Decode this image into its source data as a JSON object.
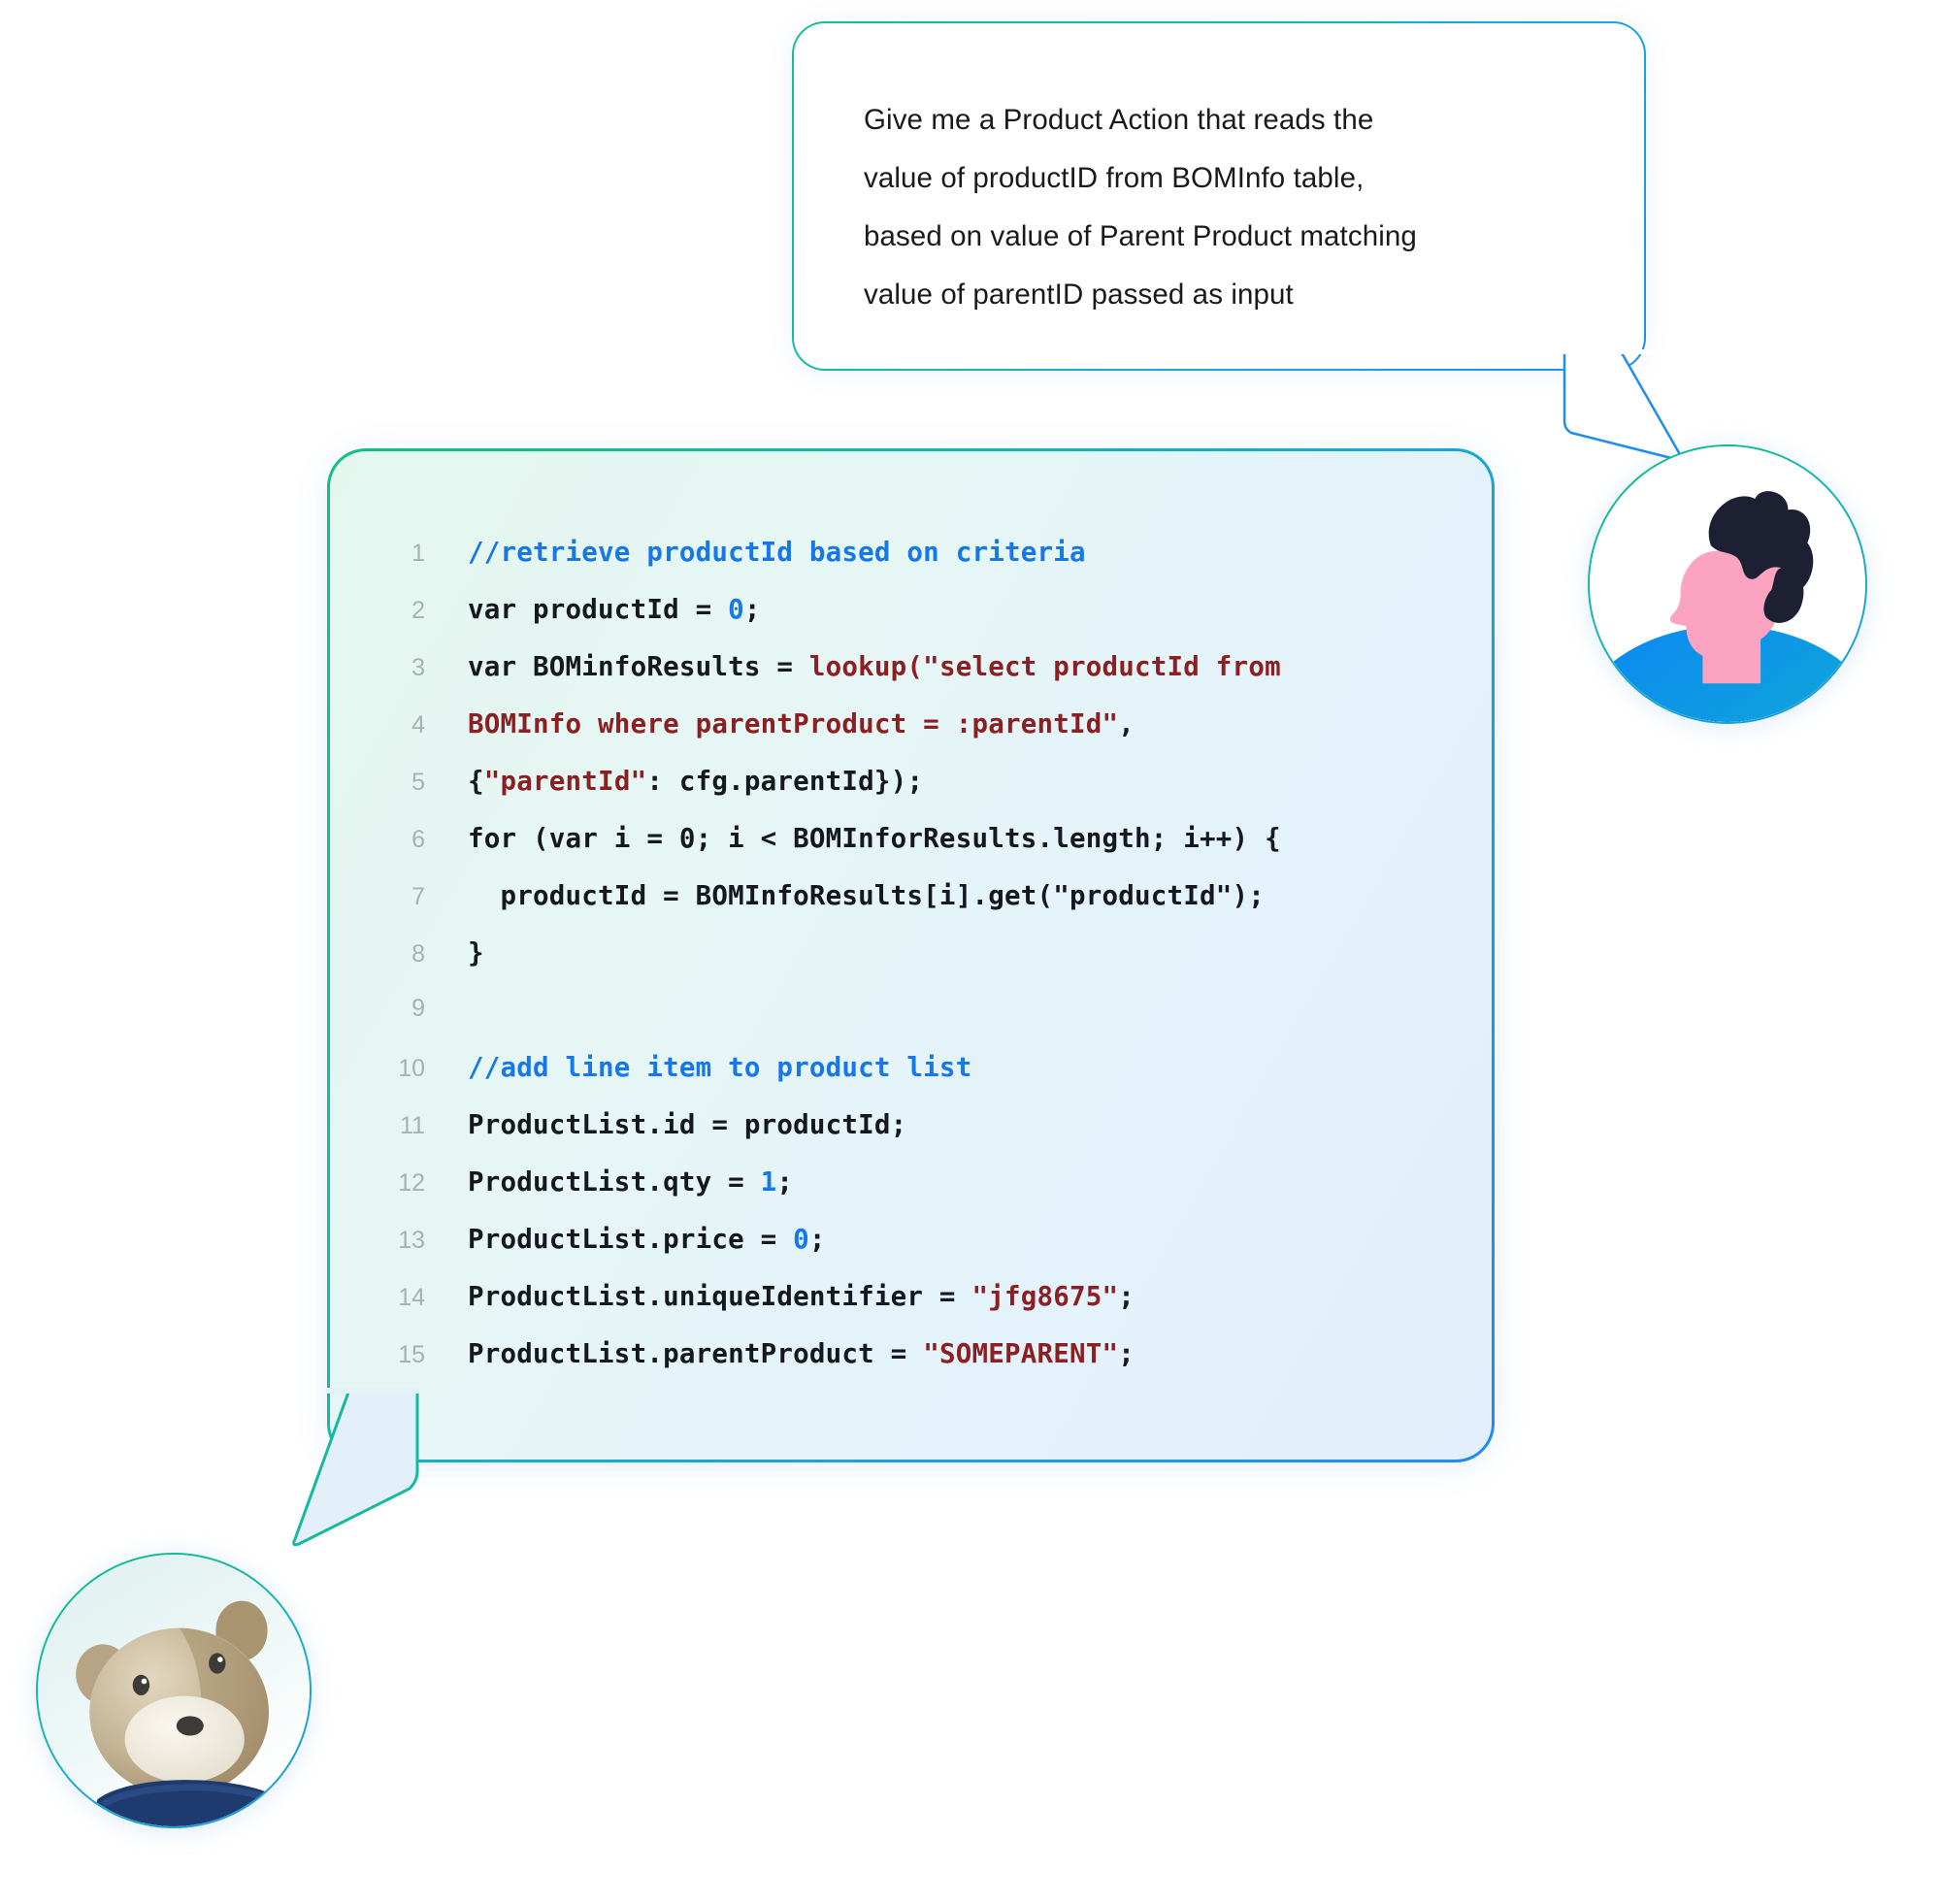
{
  "question": {
    "text": "Give me a Product Action that reads the\nvalue of productID from BOMInfo table,\nbased on value of Parent Product matching\nvalue of parentID passed as input"
  },
  "colors": {
    "comment": "#1677e8",
    "string": "#8c1f22",
    "number": "#1677e8",
    "code_text": "#15181c",
    "line_number": "#a7b0b2",
    "bubble_border_start": "#12bf83",
    "bubble_border_end": "#1f8cf1",
    "code_bubble_bg": "#e4f4f2"
  },
  "avatars": {
    "user": {
      "name": "person-avatar",
      "hair": "#1d2033",
      "skin": "#f9a0bd",
      "shirt_top": "#0d8bf2",
      "shirt_bottom": "#14b5c4"
    },
    "assistant": {
      "name": "bear-avatar",
      "fur_light": "#d9cdb4",
      "fur_dark": "#a08b6b",
      "muzzle": "#f2ede2",
      "scarf": "#1f3a6e",
      "bg": "#e8f5f4"
    }
  },
  "code": {
    "language": "javascript",
    "lines": [
      {
        "n": "1",
        "tokens": [
          {
            "t": "//retrieve productId based on criteria",
            "c": "comment"
          }
        ]
      },
      {
        "n": "2",
        "tokens": [
          {
            "t": "var productId = ",
            "c": "plain"
          },
          {
            "t": "0",
            "c": "num"
          },
          {
            "t": ";",
            "c": "plain"
          }
        ]
      },
      {
        "n": "3",
        "tokens": [
          {
            "t": "var BOMinfoResults = ",
            "c": "plain"
          },
          {
            "t": "lookup(\"select productId from",
            "c": "string"
          }
        ]
      },
      {
        "n": "4",
        "tokens": [
          {
            "t": "BOMInfo where parentProduct = :parentId\"",
            "c": "string"
          },
          {
            "t": ",",
            "c": "plain"
          }
        ]
      },
      {
        "n": "5",
        "tokens": [
          {
            "t": "{",
            "c": "plain"
          },
          {
            "t": "\"parentId\"",
            "c": "string"
          },
          {
            "t": ": cfg.parentId});",
            "c": "plain"
          }
        ]
      },
      {
        "n": "6",
        "tokens": [
          {
            "t": "for (var i = 0; i < BOMInforResults.length; i++) {",
            "c": "plain"
          }
        ]
      },
      {
        "n": "7",
        "tokens": [
          {
            "t": "  productId = BOMInfoResults[i].get(\"productId\");",
            "c": "plain"
          }
        ]
      },
      {
        "n": "8",
        "tokens": [
          {
            "t": "}",
            "c": "plain"
          }
        ]
      },
      {
        "n": "9",
        "tokens": [
          {
            "t": "",
            "c": "plain"
          }
        ]
      },
      {
        "n": "10",
        "tokens": [
          {
            "t": "//add line item to product list",
            "c": "comment"
          }
        ]
      },
      {
        "n": "11",
        "tokens": [
          {
            "t": "ProductList.id = productId;",
            "c": "plain"
          }
        ]
      },
      {
        "n": "12",
        "tokens": [
          {
            "t": "ProductList.qty = ",
            "c": "plain"
          },
          {
            "t": "1",
            "c": "num"
          },
          {
            "t": ";",
            "c": "plain"
          }
        ]
      },
      {
        "n": "13",
        "tokens": [
          {
            "t": "ProductList.price = ",
            "c": "plain"
          },
          {
            "t": "0",
            "c": "num"
          },
          {
            "t": ";",
            "c": "plain"
          }
        ]
      },
      {
        "n": "14",
        "tokens": [
          {
            "t": "ProductList.uniqueIdentifier = ",
            "c": "plain"
          },
          {
            "t": "\"jfg8675\"",
            "c": "string"
          },
          {
            "t": ";",
            "c": "plain"
          }
        ]
      },
      {
        "n": "15",
        "tokens": [
          {
            "t": "ProductList.parentProduct = ",
            "c": "plain"
          },
          {
            "t": "\"SOMEPARENT\"",
            "c": "string"
          },
          {
            "t": ";",
            "c": "plain"
          }
        ]
      }
    ]
  }
}
